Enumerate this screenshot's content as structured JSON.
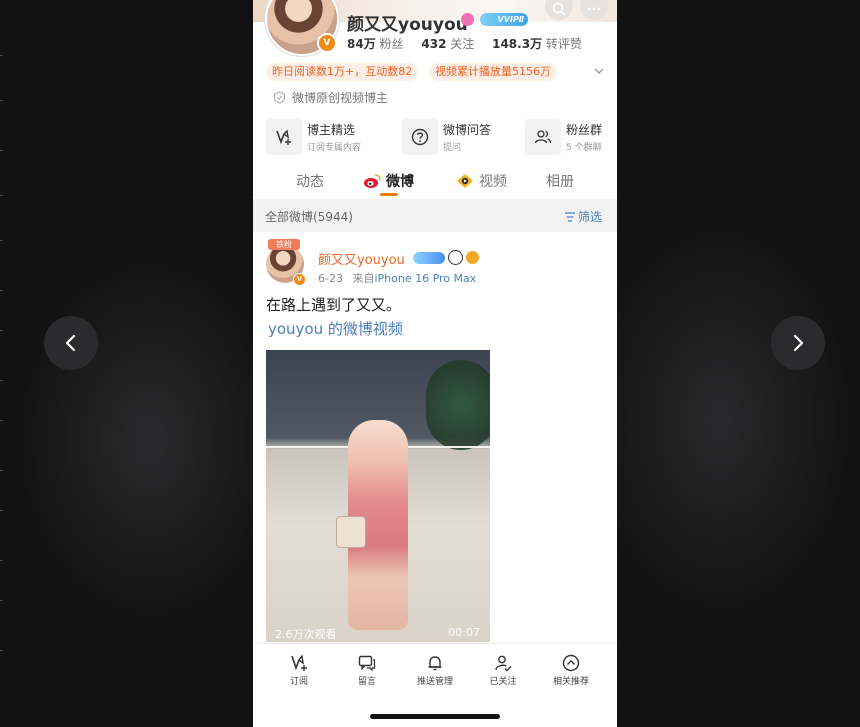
{
  "viewer": {
    "prev_label": "previous",
    "next_label": "next"
  },
  "profile": {
    "name": "颜又又youyou",
    "vip_badge": "VVIPⅡ",
    "stats": [
      {
        "value": "84万",
        "label": "粉丝"
      },
      {
        "value": "432",
        "label": "关注"
      },
      {
        "value": "148.3万",
        "label": "转评赞"
      }
    ],
    "highlights": [
      "昨日阅读数1万+，互动数82",
      "视频累计播放量5156万"
    ],
    "verified_text": "微博原创视频博主",
    "verified_mark": "V"
  },
  "features": [
    {
      "title": "博主精选",
      "sub": "订阅专属内容",
      "icon": "subscribe-icon"
    },
    {
      "title": "微博问答",
      "sub": "提问",
      "icon": "question-icon"
    },
    {
      "title": "粉丝群",
      "sub": "5 个群聊",
      "icon": "group-icon"
    }
  ],
  "tabs": [
    {
      "label": "动态"
    },
    {
      "label": "微博"
    },
    {
      "label": "视频"
    },
    {
      "label": "相册"
    }
  ],
  "feed": {
    "all_label": "全部微博(5944)",
    "filter_label": "筛选"
  },
  "post": {
    "fan_tag": "铁粉",
    "author": "颜又又youyou",
    "date": "6-23",
    "source_prefix": "来自",
    "device": "iPhone 16 Pro Max",
    "text_line1": "在路上遇到了又又。",
    "text_line2": "youyou 的微博视频",
    "video": {
      "views": "2.6万次观看",
      "duration": "00:07"
    }
  },
  "bottom_bar": [
    {
      "label": "订阅",
      "icon": "subscribe-icon"
    },
    {
      "label": "留言",
      "icon": "comment-icon"
    },
    {
      "label": "推送管理",
      "icon": "bell-icon"
    },
    {
      "label": "已关注",
      "icon": "followed-icon"
    },
    {
      "label": "相关推荐",
      "icon": "recommend-icon"
    }
  ],
  "colors": {
    "accent": "#f57b12",
    "link": "#4a7fc0",
    "pill_bg": "#fdeee6",
    "pill_text": "#f06020"
  }
}
